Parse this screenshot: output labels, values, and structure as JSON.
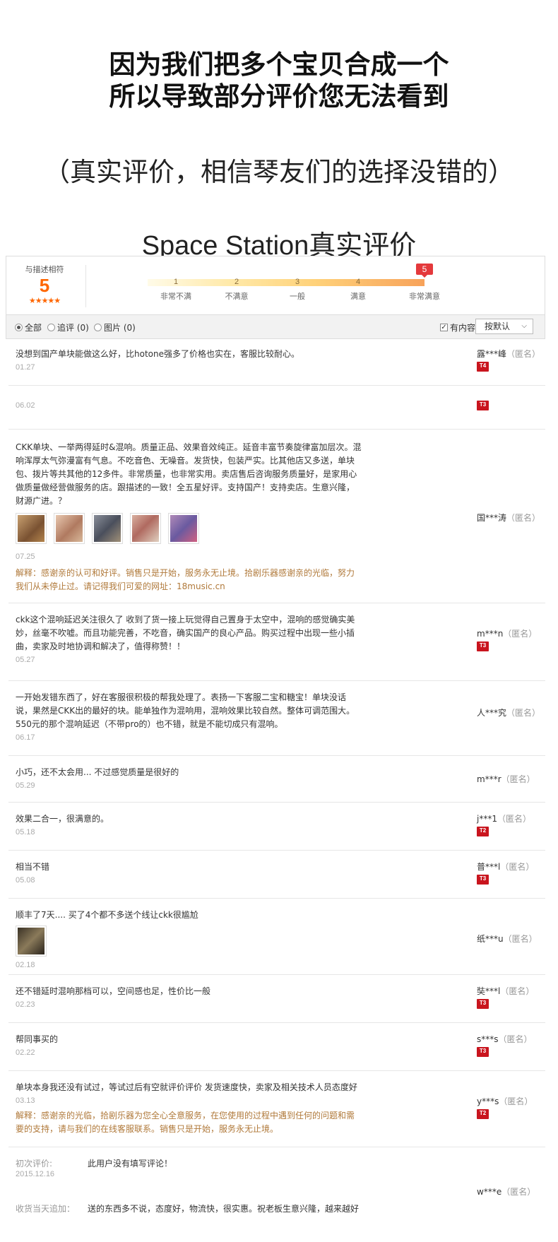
{
  "banner": {
    "line1": "因为我们把多个宝贝合成一个",
    "line2": "所以导致部分评价您无法看到",
    "subline": "（真实评价，相信琴友们的选择没错的）",
    "section_title": "Space Station真实评价"
  },
  "rating": {
    "label": "与描述相符",
    "score": "5",
    "stars": "★★★★★",
    "level": 5,
    "ticks": [
      "1",
      "2",
      "3",
      "4",
      "5"
    ],
    "tick_labels": [
      "非常不满",
      "不满意",
      "一般",
      "满意",
      "非常满意"
    ],
    "active_color": "#e4393c"
  },
  "filters": {
    "all": "全部",
    "append": "追评 (0)",
    "image": "图片 (0)",
    "has_content": "有内容",
    "sort": "按默认"
  },
  "reviews": [
    {
      "text": "没想到国产单块能做这么好，比hotone强多了价格也实在，客服比较耐心。",
      "date": "01.27",
      "user": "露***峰",
      "anon": "（匿名）",
      "badge": "T4"
    },
    {
      "text": "",
      "date": "06.02",
      "user": "",
      "anon": "",
      "badge": "T3"
    },
    {
      "text": "CKK单块、一举两得延时&混响。质量正品、效果音效纯正。延音丰富节奏旋律富加层次。混响浑厚太气弥漫富有气息。不吃音色、无噪音。发货快，包装严实。比其他店又多送，单块包、拨片等共其他的12多件。非常质量，也非常实用。卖店售后咨询服务质量好，是家用心做质量做经营做服务的店。跟描述的一致！全五星好评。支持国产！支持卖店。生意兴隆，财源广进。？",
      "date": "07.25",
      "user": "国***涛",
      "anon": "（匿名）",
      "badge": "",
      "reply": "解释：感谢亲的认可和好评。销售只是开始，服务永无止境。拾剧乐器感谢亲的光临，努力我们从未停止过。请记得我们可爱的网址：18music.cn"
    },
    {
      "text": "ckk这个混响延迟关注很久了 收到了货一接上玩觉得自己置身于太空中，混响的感觉确实美妙，丝毫不吹嘘。而且功能完善，不吃音，确实国产的良心产品。购买过程中出现一些小插曲，卖家及时地协调和解决了，值得称赞！！",
      "date": "05.27",
      "user": "m***n",
      "anon": "（匿名）",
      "badge": "T3"
    },
    {
      "text": "一开始发错东西了，好在客服很积极的帮我处理了。表扬一下客服二宝和糖宝！单块没话说，果然是CKK出的最好的块。能单独作为混响用，混响效果比较自然。整体可调范围大。550元的那个混响延迟（不带pro的）也不错，就是不能切成只有混响。",
      "date": "06.17",
      "user": "人***究",
      "anon": "（匿名）",
      "badge": ""
    },
    {
      "text": "小巧，还不太会用... 不过感觉质量是很好的",
      "date": "05.29",
      "user": "m***r",
      "anon": "（匿名）",
      "badge": ""
    },
    {
      "text": "效果二合一，很满意的。",
      "date": "05.18",
      "user": "j***1",
      "anon": "（匿名）",
      "badge": "T2"
    },
    {
      "text": "相当不错",
      "date": "05.08",
      "user": "普***l",
      "anon": "（匿名）",
      "badge": "T3"
    },
    {
      "text": "顺丰了7天.... 买了4个都不多送个线让ckk很尴尬",
      "date": "02.18",
      "user": "纸***u",
      "anon": "（匿名）",
      "badge": ""
    },
    {
      "text": "还不错延时混响那档可以，空间感也足，性价比一般",
      "date": "02.23",
      "user": "奘***l",
      "anon": "（匿名）",
      "badge": "T3"
    },
    {
      "text": "帮同事买的",
      "date": "02.22",
      "user": "s***s",
      "anon": "（匿名）",
      "badge": "T3"
    },
    {
      "text": "单块本身我还没有试过，等试过后有空就评价评价 发货速度快，卖家及相关技术人员态度好",
      "date": "03.13",
      "user": "y***s",
      "anon": "（匿名）",
      "badge": "T2",
      "reply": "解释：感谢亲的光临，拾剧乐器为您全心全意服务，在您使用的过程中遇到任何的问题和需要的支持，请与我们的在线客服联系。销售只是开始，服务永无止境。"
    },
    {
      "initial_label": "初次评价:",
      "initial_text": "此用户没有填写评论！",
      "date": "2015.12.16",
      "followup_label": "收货当天追加：",
      "followup_text": "送的东西多不说，态度好，物流快，很实惠。祝老板生意兴隆，越来越好",
      "user": "w***e",
      "anon": "（匿名）",
      "badge": ""
    }
  ]
}
